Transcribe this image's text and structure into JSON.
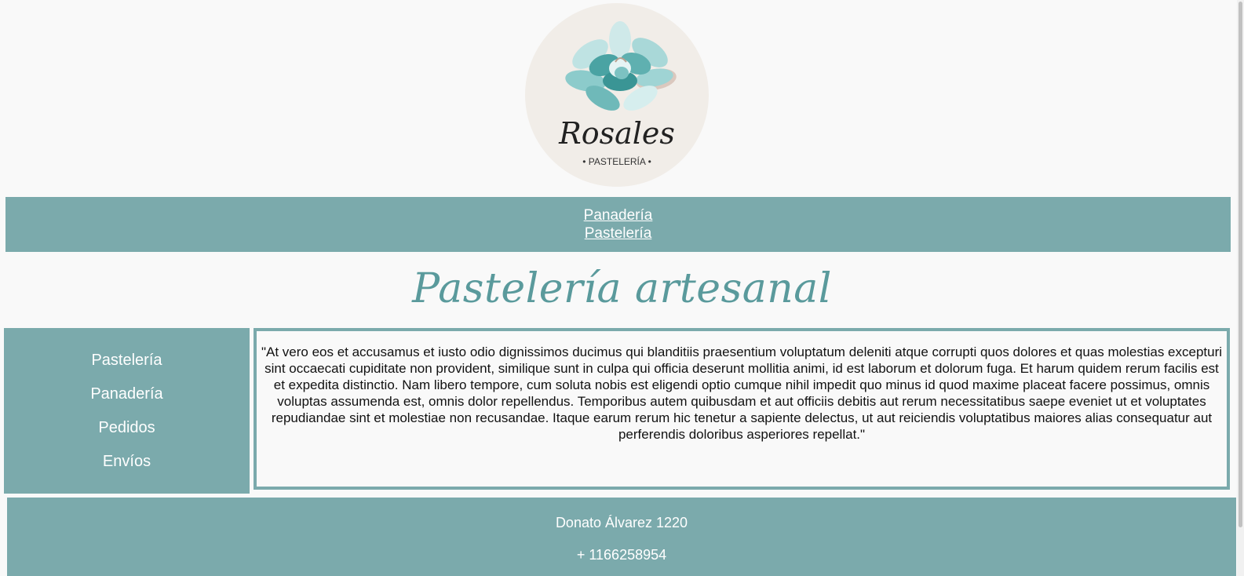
{
  "logo": {
    "brand": "Rosales",
    "tagline": "• PASTELERÍA •",
    "icon": "succulent-flower-logo"
  },
  "topnav": {
    "items": [
      {
        "label": "Panadería"
      },
      {
        "label": "Pastelería"
      }
    ]
  },
  "main": {
    "title": "Pastelería artesanal",
    "body": "\"At vero eos et accusamus et iusto odio dignissimos ducimus qui blanditiis praesentium voluptatum deleniti atque corrupti quos dolores et quas molestias excepturi sint occaecati cupiditate non provident, similique sunt in culpa qui officia deserunt mollitia animi, id est laborum et dolorum fuga. Et harum quidem rerum facilis est et expedita distinctio. Nam libero tempore, cum soluta nobis est eligendi optio cumque nihil impedit quo minus id quod maxime placeat facere possimus, omnis voluptas assumenda est, omnis dolor repellendus. Temporibus autem quibusdam et aut officiis debitis aut rerum necessitatibus saepe eveniet ut et voluptates repudiandae sint et molestiae non recusandae. Itaque earum rerum hic tenetur a sapiente delectus, ut aut reiciendis voluptatibus maiores alias consequatur aut perferendis doloribus asperiores repellat.\""
  },
  "sidebar": {
    "items": [
      {
        "label": "Pastelería"
      },
      {
        "label": "Panadería"
      },
      {
        "label": "Pedidos"
      },
      {
        "label": "Envíos"
      }
    ]
  },
  "footer": {
    "address": "Donato Álvarez 1220",
    "phone": "+ 1166258954"
  },
  "colors": {
    "accent": "#7baaac",
    "title": "#5a9a9c",
    "background": "#f9f9f9",
    "logo_circle": "#f1ede8"
  }
}
